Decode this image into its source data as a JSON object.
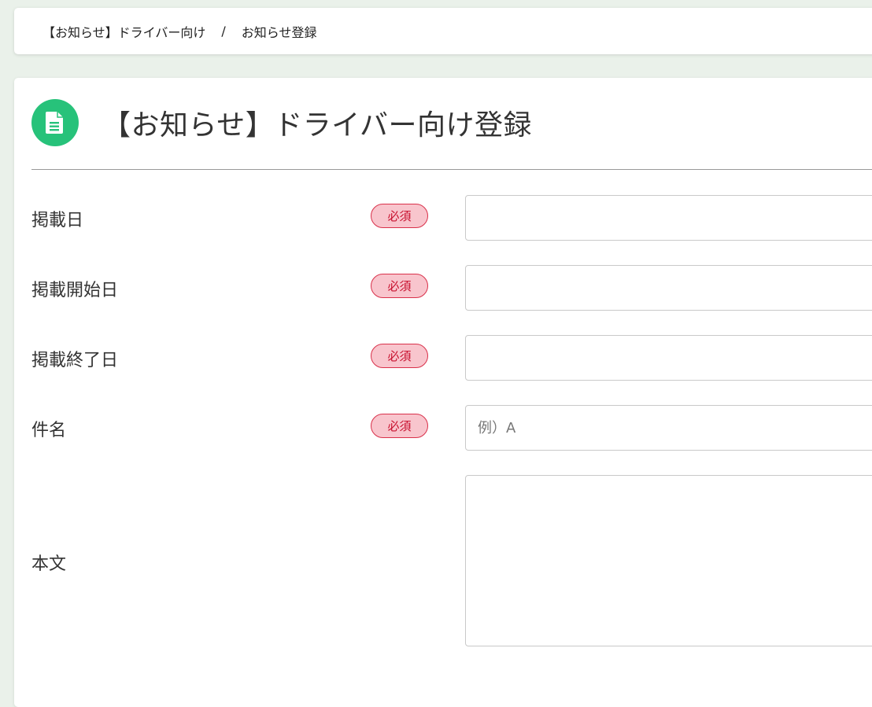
{
  "breadcrumb": {
    "parent": "【お知らせ】ドライバー向け",
    "separator": "/",
    "current": "お知らせ登録"
  },
  "header": {
    "title": "【お知らせ】ドライバー向け登録",
    "icon": "document-icon",
    "icon_color": "#27c27a"
  },
  "form": {
    "required_label": "必須",
    "fields": [
      {
        "label": "掲載日",
        "required": true,
        "value": "",
        "placeholder": ""
      },
      {
        "label": "掲載開始日",
        "required": true,
        "value": "",
        "placeholder": ""
      },
      {
        "label": "掲載終了日",
        "required": true,
        "value": "",
        "placeholder": ""
      },
      {
        "label": "件名",
        "required": true,
        "value": "",
        "placeholder": "例）A"
      },
      {
        "label": "本文",
        "required": false,
        "value": "",
        "placeholder": ""
      }
    ]
  },
  "colors": {
    "background": "#eaf1ea",
    "required_badge_bg": "#f8c5cd",
    "required_badge_border": "#d9304a",
    "required_badge_text": "#c8102e"
  }
}
